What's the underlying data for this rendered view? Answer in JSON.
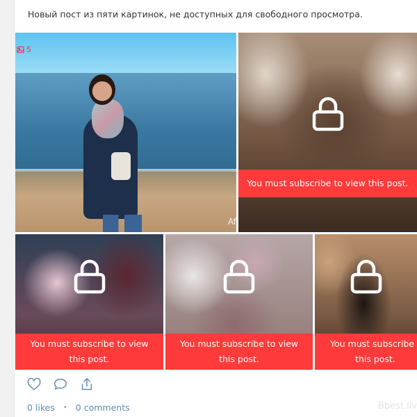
{
  "post": {
    "text": "Новый пост из пяти картинок, не доступных для свободного просмотра.",
    "image_count": "5",
    "watermark": "Af"
  },
  "locked_message_line1": "You must subscribe to view",
  "locked_message_line2": "this post.",
  "locked_message_full": "You must subscribe to view this post.",
  "locked_message_tile5_line1": "You must subscribe to",
  "locked_message_tile5_line2": "this post.",
  "icons": [
    "image-icon",
    "lock-icon",
    "heart-icon",
    "comment-icon",
    "share-icon"
  ],
  "stats": {
    "likes": "0 likes",
    "separator": "•",
    "comments": "0 comments"
  },
  "brand": "Bbest.liv",
  "colors": {
    "accent": "#ff3a3a",
    "link": "#5e8cb0",
    "text": "#333333"
  }
}
